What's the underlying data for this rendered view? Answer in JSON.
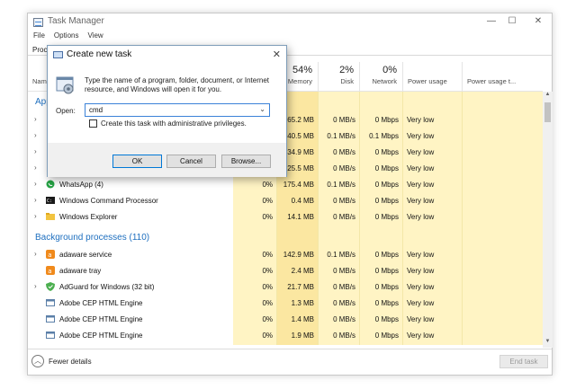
{
  "window": {
    "title": "Task Manager",
    "min_glyph": "—",
    "max_glyph": "☐",
    "close_glyph": "✕"
  },
  "menu": [
    "File",
    "Options",
    "View"
  ],
  "tabs": {
    "processes_partial": "Proc"
  },
  "columns": {
    "name_partial": "Nam",
    "memory": {
      "pct": "54%",
      "label": "Memory"
    },
    "disk": {
      "pct": "2%",
      "label": "Disk"
    },
    "network": {
      "pct": "0%",
      "label": "Network"
    },
    "power_usage": "Power usage",
    "power_usage_trend": "Power usage t..."
  },
  "groups": {
    "apps_partial": "App",
    "background": "Background processes (110)"
  },
  "app_rows_hidden": [
    {
      "memory": "165.2 MB",
      "disk": "0 MB/s",
      "network": "0 Mbps",
      "power": "Very low"
    },
    {
      "memory": "340.5 MB",
      "disk": "0.1 MB/s",
      "network": "0.1 Mbps",
      "power": "Very low"
    },
    {
      "memory": "134.9 MB",
      "disk": "0 MB/s",
      "network": "0 Mbps",
      "power": "Very low"
    },
    {
      "memory": "25.5 MB",
      "disk": "0 MB/s",
      "network": "0 Mbps",
      "power": "Very low"
    }
  ],
  "app_rows": [
    {
      "name": "WhatsApp (4)",
      "cpu": "0%",
      "memory": "175.4 MB",
      "disk": "0.1 MB/s",
      "network": "0 Mbps",
      "power": "Very low"
    },
    {
      "name": "Windows Command Processor",
      "cpu": "0%",
      "memory": "0.4 MB",
      "disk": "0 MB/s",
      "network": "0 Mbps",
      "power": "Very low"
    },
    {
      "name": "Windows Explorer",
      "cpu": "0%",
      "memory": "14.1 MB",
      "disk": "0 MB/s",
      "network": "0 Mbps",
      "power": "Very low"
    }
  ],
  "bg_rows": [
    {
      "name": "adaware service",
      "cpu": "0%",
      "memory": "142.9 MB",
      "disk": "0.1 MB/s",
      "network": "0 Mbps",
      "power": "Very low"
    },
    {
      "name": "adaware tray",
      "cpu": "0%",
      "memory": "2.4 MB",
      "disk": "0 MB/s",
      "network": "0 Mbps",
      "power": "Very low"
    },
    {
      "name": "AdGuard for Windows (32 bit)",
      "cpu": "0%",
      "memory": "21.7 MB",
      "disk": "0 MB/s",
      "network": "0 Mbps",
      "power": "Very low"
    },
    {
      "name": "Adobe CEP HTML Engine",
      "cpu": "0%",
      "memory": "1.3 MB",
      "disk": "0 MB/s",
      "network": "0 Mbps",
      "power": "Very low"
    },
    {
      "name": "Adobe CEP HTML Engine",
      "cpu": "0%",
      "memory": "1.4 MB",
      "disk": "0 MB/s",
      "network": "0 Mbps",
      "power": "Very low"
    },
    {
      "name": "Adobe CEP HTML Engine",
      "cpu": "0%",
      "memory": "1.9 MB",
      "disk": "0 MB/s",
      "network": "0 Mbps",
      "power": "Very low"
    }
  ],
  "footer": {
    "fewer_details": "Fewer details",
    "end_task": "End task"
  },
  "dialog": {
    "title": "Create new task",
    "close_glyph": "✕",
    "description": "Type the name of a program, folder, document, or Internet resource, and Windows will open it for you.",
    "open_label": "Open:",
    "open_value": "cmd",
    "admin_label": "Create this task with administrative privileges.",
    "ok": "OK",
    "cancel": "Cancel",
    "browse": "Browse..."
  },
  "colors": {
    "accent_blue": "#1e6fbf",
    "heat_light": "#fff4c4",
    "heat_mid": "#fbe7a1"
  }
}
